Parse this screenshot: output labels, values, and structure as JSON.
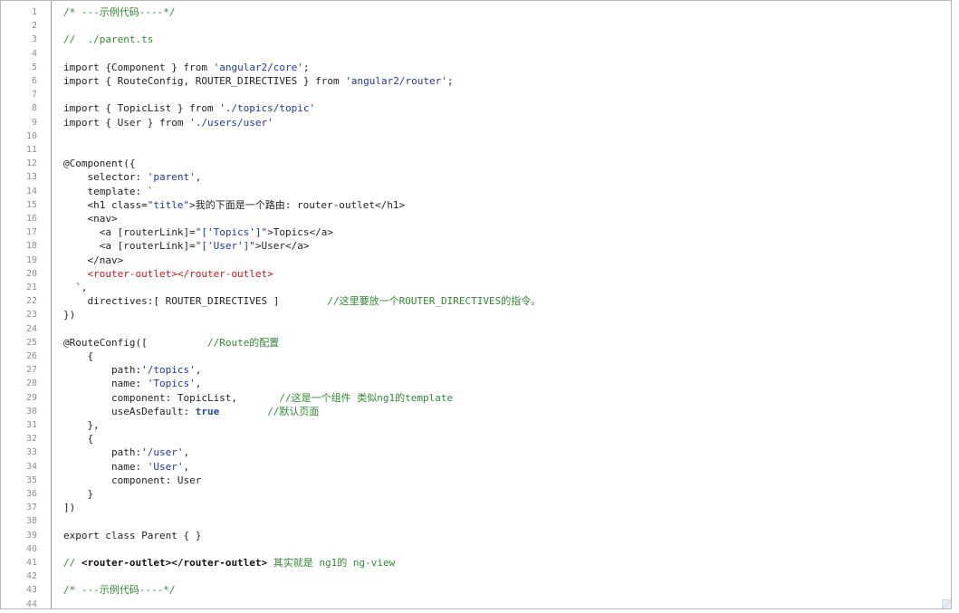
{
  "line_numbers": [
    "1",
    "2",
    "3",
    "4",
    "5",
    "6",
    "7",
    "8",
    "9",
    "10",
    "11",
    "12",
    "13",
    "14",
    "15",
    "16",
    "17",
    "18",
    "19",
    "20",
    "21",
    "22",
    "23",
    "24",
    "25",
    "26",
    "27",
    "28",
    "29",
    "30",
    "31",
    "32",
    "33",
    "34",
    "35",
    "36",
    "37",
    "38",
    "39",
    "40",
    "41",
    "42",
    "43",
    "44"
  ],
  "lines": [
    [
      {
        "text": "/* ---示例代码----*/",
        "type": "comment"
      }
    ],
    [],
    [
      {
        "text": "//  ./parent.ts",
        "type": "comment"
      }
    ],
    [],
    [
      {
        "text": "import {Component } from ",
        "type": "plain"
      },
      {
        "text": "'angular2/core'",
        "type": "string"
      },
      {
        "text": ";",
        "type": "plain"
      }
    ],
    [
      {
        "text": "import { RouteConfig, ROUTER_DIRECTIVES } from ",
        "type": "plain"
      },
      {
        "text": "'angular2/router'",
        "type": "string"
      },
      {
        "text": ";",
        "type": "plain"
      }
    ],
    [],
    [
      {
        "text": "import { TopicList } from ",
        "type": "plain"
      },
      {
        "text": "'./topics/topic'",
        "type": "string"
      }
    ],
    [
      {
        "text": "import { User } from ",
        "type": "plain"
      },
      {
        "text": "'./users/user'",
        "type": "string"
      }
    ],
    [],
    [],
    [
      {
        "text": "@Component({",
        "type": "plain"
      }
    ],
    [
      {
        "text": "    selector: ",
        "type": "plain"
      },
      {
        "text": "'parent'",
        "type": "string"
      },
      {
        "text": ",",
        "type": "plain"
      }
    ],
    [
      {
        "text": "    template: `",
        "type": "plain"
      }
    ],
    [
      {
        "text": "    <h1 class=",
        "type": "plain"
      },
      {
        "text": "\"title\"",
        "type": "string"
      },
      {
        "text": ">我的下面是一个路由: router-outlet</h1>",
        "type": "plain"
      }
    ],
    [
      {
        "text": "    <nav>",
        "type": "plain"
      }
    ],
    [
      {
        "text": "      <a [routerLink]=",
        "type": "plain"
      },
      {
        "text": "\"['Topics']\"",
        "type": "string"
      },
      {
        "text": ">Topics</a>",
        "type": "plain"
      }
    ],
    [
      {
        "text": "      <a [routerLink]=",
        "type": "plain"
      },
      {
        "text": "\"['User']\"",
        "type": "string"
      },
      {
        "text": ">User</a>",
        "type": "plain"
      }
    ],
    [
      {
        "text": "    </nav>",
        "type": "plain"
      }
    ],
    [
      {
        "text": "    <router-outlet></router-outlet>",
        "type": "tag"
      }
    ],
    [
      {
        "text": "  `,",
        "type": "plain"
      }
    ],
    [
      {
        "text": "    directives:[ ROUTER_DIRECTIVES ]        ",
        "type": "plain"
      },
      {
        "text": "//这里要放一个ROUTER_DIRECTIVES的指令。",
        "type": "comment"
      }
    ],
    [
      {
        "text": "})",
        "type": "plain"
      }
    ],
    [],
    [
      {
        "text": "@RouteConfig([          ",
        "type": "plain"
      },
      {
        "text": "//Route的配置",
        "type": "comment"
      }
    ],
    [
      {
        "text": "    {",
        "type": "plain"
      }
    ],
    [
      {
        "text": "        path:",
        "type": "plain"
      },
      {
        "text": "'/topics'",
        "type": "string"
      },
      {
        "text": ",",
        "type": "plain"
      }
    ],
    [
      {
        "text": "        name: ",
        "type": "plain"
      },
      {
        "text": "'Topics'",
        "type": "string"
      },
      {
        "text": ",",
        "type": "plain"
      }
    ],
    [
      {
        "text": "        component: TopicList,       ",
        "type": "plain"
      },
      {
        "text": "//这是一个组件 类似ng1的template",
        "type": "comment"
      }
    ],
    [
      {
        "text": "        useAsDefault: ",
        "type": "plain"
      },
      {
        "text": "true",
        "type": "keyword"
      },
      {
        "text": "        ",
        "type": "plain"
      },
      {
        "text": "//默认页面",
        "type": "comment"
      }
    ],
    [
      {
        "text": "    },",
        "type": "plain"
      }
    ],
    [
      {
        "text": "    {",
        "type": "plain"
      }
    ],
    [
      {
        "text": "        path:",
        "type": "plain"
      },
      {
        "text": "'/user'",
        "type": "string"
      },
      {
        "text": ",",
        "type": "plain"
      }
    ],
    [
      {
        "text": "        name: ",
        "type": "plain"
      },
      {
        "text": "'User'",
        "type": "string"
      },
      {
        "text": ",",
        "type": "plain"
      }
    ],
    [
      {
        "text": "        component: User",
        "type": "plain"
      }
    ],
    [
      {
        "text": "    }",
        "type": "plain"
      }
    ],
    [
      {
        "text": "])",
        "type": "plain"
      }
    ],
    [],
    [
      {
        "text": "export class Parent { }",
        "type": "plain"
      }
    ],
    [],
    [
      {
        "text": "// ",
        "type": "comment"
      },
      {
        "text": "<router-outlet></router-outlet>",
        "type": "strong"
      },
      {
        "text": " 其实就是 ng1的 ng-view",
        "type": "comment"
      }
    ],
    [],
    [
      {
        "text": "/* ---示例代码----*/",
        "type": "comment"
      }
    ],
    []
  ]
}
